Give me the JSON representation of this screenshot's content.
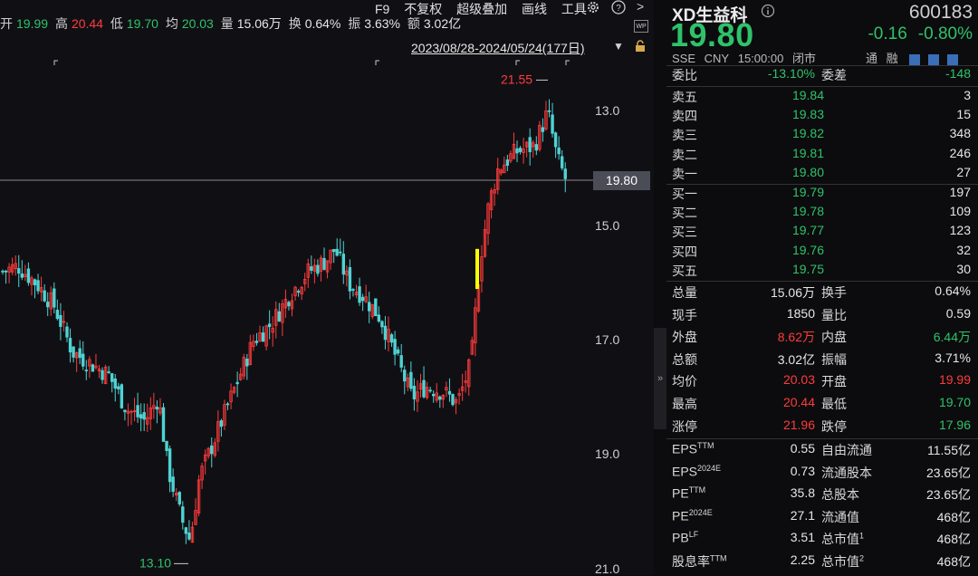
{
  "quote_bar": {
    "open_label": "开",
    "open": "19.99",
    "high_label": "高",
    "high": "20.44",
    "low_label": "低",
    "low": "19.70",
    "avg_label": "均",
    "avg": "20.03",
    "vol_label": "量",
    "vol": "15.06万",
    "turn_label": "换",
    "turn": "0.64%",
    "amp_label": "振",
    "amp": "3.63%",
    "amt_label": "额",
    "amt": "3.02亿"
  },
  "toolbar": {
    "items": [
      "F9",
      "不复权",
      "超级叠加",
      "画线",
      "工具"
    ],
    "icons": [
      "gear-icon",
      "help-icon",
      "chevron-right-icon"
    ]
  },
  "range_text": "2023/08/28-2024/05/24(177日)",
  "axis": {
    "ticks": [
      "21.0",
      "19.0",
      "17.0",
      "15.0",
      "13.0"
    ],
    "current": "19.80"
  },
  "chart_annotations": {
    "high": "21.55",
    "low": "13.10"
  },
  "chart_data": {
    "type": "candlestick",
    "ylim": [
      12.9,
      22.0
    ],
    "y_ticks": [
      13.0,
      15.0,
      17.0,
      19.0,
      21.0
    ],
    "period": "2023/08/28-2024/05/24",
    "sessions": 177,
    "current_price": 19.8,
    "max_high": 21.55,
    "min_low": 13.1,
    "colors": {
      "up": "#ff3b3b",
      "down": "#4fd3d3",
      "marker": "#ffff00"
    }
  },
  "panel": {
    "name": "XD生益科",
    "code": "600183",
    "price": "19.80",
    "change": "-0.16",
    "change_pct": "-0.80%",
    "meta": [
      "SSE",
      "CNY",
      "15:00:00",
      "闭市"
    ],
    "tags": [
      "通",
      "融"
    ],
    "weibi": {
      "label": "委比",
      "value": "-13.10%",
      "label2": "委差",
      "value2": "-148"
    },
    "asks": [
      {
        "label": "卖五",
        "price": "19.84",
        "vol": "3"
      },
      {
        "label": "卖四",
        "price": "19.83",
        "vol": "15"
      },
      {
        "label": "卖三",
        "price": "19.82",
        "vol": "348"
      },
      {
        "label": "卖二",
        "price": "19.81",
        "vol": "246"
      },
      {
        "label": "卖一",
        "price": "19.80",
        "vol": "27"
      }
    ],
    "bids": [
      {
        "label": "买一",
        "price": "19.79",
        "vol": "197"
      },
      {
        "label": "买二",
        "price": "19.78",
        "vol": "109"
      },
      {
        "label": "买三",
        "price": "19.77",
        "vol": "123"
      },
      {
        "label": "买四",
        "price": "19.76",
        "vol": "32"
      },
      {
        "label": "买五",
        "price": "19.75",
        "vol": "30"
      }
    ],
    "stats": [
      {
        "l1": "总量",
        "v1": "15.06万",
        "c1": "wt",
        "l2": "换手",
        "v2": "0.64%",
        "c2": "wt"
      },
      {
        "l1": "现手",
        "v1": "1850",
        "c1": "wt",
        "l2": "量比",
        "v2": "0.59",
        "c2": "wt"
      },
      {
        "l1": "外盘",
        "v1": "8.62万",
        "c1": "up",
        "l2": "内盘",
        "v2": "6.44万",
        "c2": "dn"
      },
      {
        "l1": "总额",
        "v1": "3.02亿",
        "c1": "wt",
        "l2": "振幅",
        "v2": "3.71%",
        "c2": "wt"
      },
      {
        "l1": "均价",
        "v1": "20.03",
        "c1": "up",
        "l2": "开盘",
        "v2": "19.99",
        "c2": "up"
      },
      {
        "l1": "最高",
        "v1": "20.44",
        "c1": "up",
        "l2": "最低",
        "v2": "19.70",
        "c2": "dn"
      },
      {
        "l1": "涨停",
        "v1": "21.96",
        "c1": "up",
        "l2": "跌停",
        "v2": "17.96",
        "c2": "dn"
      }
    ],
    "fund": [
      {
        "l1": "EPS",
        "s1": "TTM",
        "v1": "0.55",
        "l2": "自由流通",
        "s2": "",
        "v2": "11.55亿"
      },
      {
        "l1": "EPS",
        "s1": "2024E",
        "v1": "0.73",
        "l2": "流通股本",
        "s2": "",
        "v2": "23.65亿"
      },
      {
        "l1": "PE",
        "s1": "TTM",
        "v1": "35.8",
        "l2": "总股本",
        "s2": "",
        "v2": "23.65亿"
      },
      {
        "l1": "PE",
        "s1": "2024E",
        "v1": "27.1",
        "l2": "流通值",
        "s2": "",
        "v2": "468亿"
      },
      {
        "l1": "PB",
        "s1": "LF",
        "v1": "3.51",
        "l2": "总市值",
        "s2": "1",
        "v2": "468亿"
      },
      {
        "l1": "股息率",
        "s1": "TTM",
        "v1": "2.25",
        "l2": "总市值",
        "s2": "2",
        "v2": "468亿"
      }
    ]
  }
}
